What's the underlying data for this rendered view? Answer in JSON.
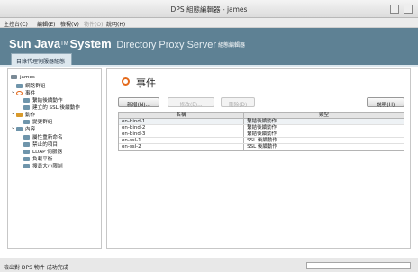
{
  "window": {
    "title": "DPS 組態編輯器 - james"
  },
  "menubar": {
    "items": [
      {
        "label": "主控台(C)",
        "enabled": true
      },
      {
        "label": "編輯(E)",
        "enabled": true
      },
      {
        "label": "檢視(V)",
        "enabled": true
      },
      {
        "label": "物件(O)",
        "enabled": false
      },
      {
        "label": "說明(H)",
        "enabled": true
      }
    ]
  },
  "banner": {
    "brand_main": "Sun Java",
    "brand_tm": "TM",
    "brand_system": "System",
    "brand_product": "Directory Proxy Server",
    "subtitle": "組態編輯器",
    "tab_label": "目錄代理伺服器組態",
    "color": "#5e8194"
  },
  "tree": {
    "items": [
      {
        "label": "james",
        "icon": "server-icon"
      },
      {
        "label": "網路群組",
        "icon": "folder-icon"
      },
      {
        "label": "事件",
        "icon": "events-icon"
      },
      {
        "label": "繫結後續動作",
        "icon": "folder-icon"
      },
      {
        "label": "建立的 SSL 後續動作",
        "icon": "folder-icon"
      },
      {
        "label": "動作",
        "icon": "actions-icon"
      },
      {
        "label": "變更群組",
        "icon": "folder-icon"
      },
      {
        "label": "內容",
        "icon": "folder-icon"
      },
      {
        "label": "屬性重新命名",
        "icon": "folder-icon"
      },
      {
        "label": "禁止的項目",
        "icon": "folder-icon"
      },
      {
        "label": "LDAP 伺服器",
        "icon": "folder-icon"
      },
      {
        "label": "負載平衡",
        "icon": "folder-icon"
      },
      {
        "label": "搜尋大小限制",
        "icon": "folder-icon"
      }
    ]
  },
  "content": {
    "title": "事件",
    "buttons": {
      "new_label": "新增(N)...",
      "modify_label": "修改(E)...",
      "delete_label": "刪除(D)",
      "help_label": "說明(H)"
    },
    "table": {
      "columns": [
        "名稱",
        "類型"
      ],
      "rows": [
        [
          "on-bind-1",
          "繫結後續動作"
        ],
        [
          "on-bind-2",
          "繫結後續動作"
        ],
        [
          "on-bind-3",
          "繫結後續動作"
        ],
        [
          "on-ssl-1",
          "SSL 後續動作"
        ],
        [
          "on-ssl-2",
          "SSL 後續動作"
        ]
      ]
    }
  },
  "status": {
    "text": "檢出對 DPS 物件 成功完成"
  },
  "colors": {
    "accent": "#e46a1c",
    "folder": "#6f95ab"
  }
}
